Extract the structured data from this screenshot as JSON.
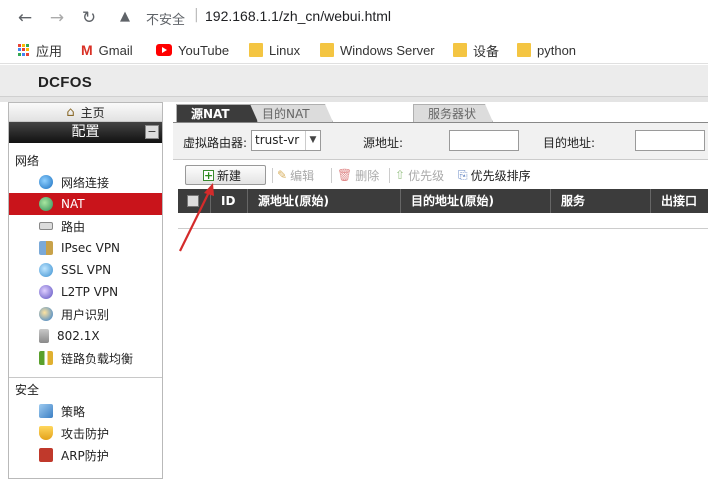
{
  "browser": {
    "insecure_label": "不安全",
    "url": "192.168.1.1/zh_cn/webui.html",
    "bookmarks": [
      {
        "label": "应用"
      },
      {
        "label": "Gmail"
      },
      {
        "label": "YouTube"
      },
      {
        "label": "Linux"
      },
      {
        "label": "Windows Server"
      },
      {
        "label": "设备"
      },
      {
        "label": "python"
      }
    ]
  },
  "app": {
    "logo": "DCFOS"
  },
  "sidebar": {
    "home": "主页",
    "config": "配置",
    "collapse": "−",
    "network_title": "网络",
    "network_items": [
      {
        "label": "网络连接",
        "icon": "globe-icon"
      },
      {
        "label": "NAT",
        "icon": "nat-globe-icon",
        "active": true
      },
      {
        "label": "路由",
        "icon": "router-icon"
      },
      {
        "label": "IPsec VPN",
        "icon": "ipsec-vpn-icon"
      },
      {
        "label": "SSL VPN",
        "icon": "ssl-vpn-icon"
      },
      {
        "label": "L2TP VPN",
        "icon": "l2tp-vpn-icon"
      },
      {
        "label": "用户识别",
        "icon": "user-identify-icon"
      },
      {
        "label": "802.1X",
        "icon": "dot1x-icon"
      },
      {
        "label": "链路负载均衡",
        "icon": "load-balance-icon"
      }
    ],
    "security_title": "安全",
    "security_items": [
      {
        "label": "策略",
        "icon": "policy-icon"
      },
      {
        "label": "攻击防护",
        "icon": "attack-defense-icon"
      },
      {
        "label": "ARP防护",
        "icon": "arp-defense-icon"
      }
    ]
  },
  "main": {
    "tabs": [
      {
        "label": "源NAT",
        "active": true
      },
      {
        "label": "目的NAT"
      },
      {
        "label": "服务器状态"
      }
    ],
    "filter": {
      "vrouter_label": "虚拟路由器:",
      "vrouter_value": "trust-vr",
      "src_addr_label": "源地址:",
      "dst_addr_label": "目的地址:"
    },
    "toolbar": {
      "new": "新建",
      "edit": "编辑",
      "delete": "删除",
      "priority": "优先级",
      "priority_sort": "优先级排序"
    },
    "table": {
      "columns": [
        "ID",
        "源地址(原始)",
        "目的地址(原始)",
        "服务",
        "出接口"
      ]
    }
  },
  "colors": {
    "active_red": "#c9141b",
    "header_dark": "#3c3c3c",
    "annotation_arrow": "#d42b2b"
  }
}
